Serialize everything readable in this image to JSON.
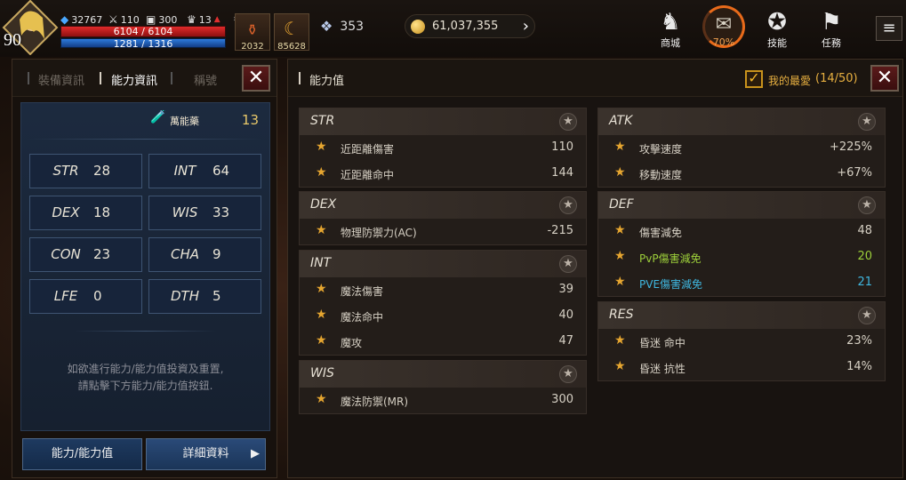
{
  "hud": {
    "level": "90",
    "power": "32767",
    "attack": "110",
    "defense": "300",
    "trophy": "13",
    "hp": "6104 / 6104",
    "mp": "1281 / 1316",
    "quick_slots": [
      {
        "name": "potion",
        "count": "2032"
      },
      {
        "name": "crescent-item",
        "count": "85628"
      }
    ],
    "crystal": "353",
    "gold": "61,037,355",
    "top_buttons": [
      {
        "label": "商城",
        "icon": "shop-icon"
      },
      {
        "label": "技能",
        "icon": "skill-icon"
      },
      {
        "label": "任務",
        "icon": "quest-icon"
      }
    ],
    "progress_label": "70%"
  },
  "left_panel": {
    "tabs": [
      "裝備資訊",
      "能力資訊",
      "稱號"
    ],
    "active_tab": 1,
    "potion_label": "萬能藥",
    "potion_count": "13",
    "stats": [
      {
        "key": "STR",
        "value": "28"
      },
      {
        "key": "INT",
        "value": "64"
      },
      {
        "key": "DEX",
        "value": "18"
      },
      {
        "key": "WIS",
        "value": "33"
      },
      {
        "key": "CON",
        "value": "23"
      },
      {
        "key": "CHA",
        "value": "9"
      },
      {
        "key": "LFE",
        "value": "0"
      },
      {
        "key": "DTH",
        "value": "5"
      }
    ],
    "info_line1": "如欲進行能力/能力值投資及重置,",
    "info_line2": "請點擊下方能力/能力值按鈕.",
    "btn_ability": "能力/能力值",
    "btn_detail": "詳細資料"
  },
  "right_panel": {
    "title": "能力值",
    "fav_label": "我的最愛",
    "fav_count": "(14/50)",
    "left_groups": [
      {
        "name": "STR",
        "rows": [
          {
            "label": "近距離傷害",
            "value": "110"
          },
          {
            "label": "近距離命中",
            "value": "144"
          }
        ]
      },
      {
        "name": "DEX",
        "rows": [
          {
            "label": "物理防禦力(AC)",
            "value": "-215"
          }
        ]
      },
      {
        "name": "INT",
        "rows": [
          {
            "label": "魔法傷害",
            "value": "39"
          },
          {
            "label": "魔法命中",
            "value": "40"
          },
          {
            "label": "魔攻",
            "value": "47"
          }
        ]
      },
      {
        "name": "WIS",
        "rows": [
          {
            "label": "魔法防禦(MR)",
            "value": "300"
          }
        ]
      }
    ],
    "right_groups": [
      {
        "name": "ATK",
        "rows": [
          {
            "label": "攻擊速度",
            "value": "+225%"
          },
          {
            "label": "移動速度",
            "value": "+67%"
          }
        ]
      },
      {
        "name": "DEF",
        "rows": [
          {
            "label": "傷害減免",
            "value": "48"
          },
          {
            "label": "PvP傷害減免",
            "value": "20",
            "style": "pvp"
          },
          {
            "label": "PVE傷害減免",
            "value": "21",
            "style": "pve"
          }
        ]
      },
      {
        "name": "RES",
        "rows": [
          {
            "label": "昏迷 命中",
            "value": "23%"
          },
          {
            "label": "昏迷 抗性",
            "value": "14%"
          }
        ]
      }
    ]
  }
}
